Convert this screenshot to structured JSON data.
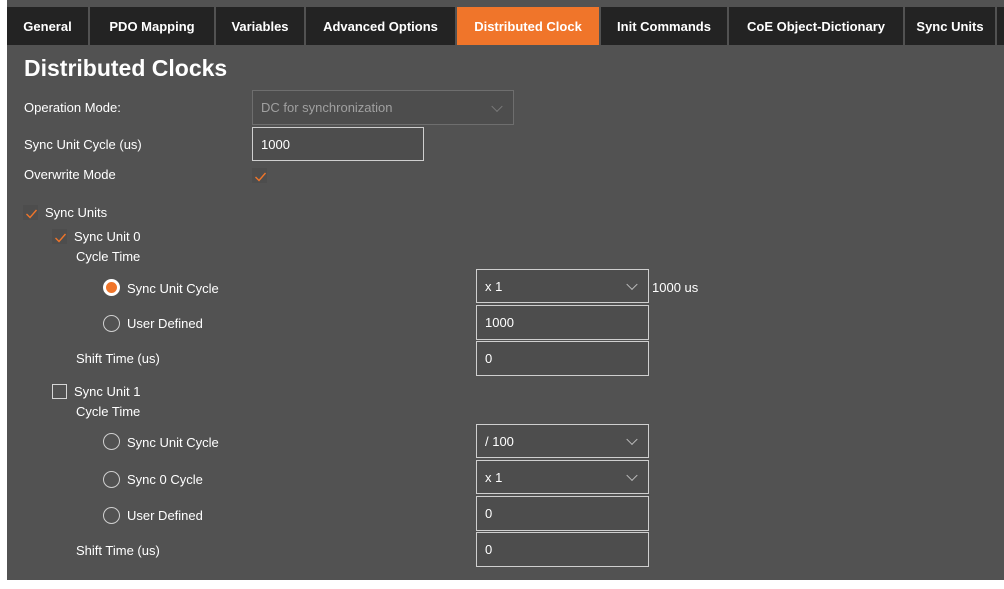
{
  "tabs": [
    {
      "label": "General",
      "active": false
    },
    {
      "label": "PDO Mapping",
      "active": false
    },
    {
      "label": "Variables",
      "active": false
    },
    {
      "label": "Advanced Options",
      "active": false
    },
    {
      "label": "Distributed Clock",
      "active": true
    },
    {
      "label": "Init Commands",
      "active": false
    },
    {
      "label": "CoE Object-Dictionary",
      "active": false
    },
    {
      "label": "Sync Units",
      "active": false
    }
  ],
  "heading": "Distributed Clocks",
  "operation_mode": {
    "label": "Operation Mode:",
    "value": "DC for synchronization",
    "enabled": false
  },
  "sync_unit_cycle": {
    "label": "Sync Unit Cycle (us)",
    "value": "1000"
  },
  "overwrite_mode": {
    "label": "Overwrite Mode",
    "checked": true
  },
  "sync_units": {
    "label": "Sync Units",
    "checked": true,
    "unit0": {
      "label": "Sync Unit 0",
      "checked": true,
      "cycle_time_label": "Cycle Time",
      "sync_unit_cycle": {
        "label": "Sync Unit Cycle",
        "selected": true,
        "value": "x 1",
        "unit_text": "1000 us"
      },
      "user_defined": {
        "label": "User Defined",
        "selected": false,
        "value": "1000"
      },
      "shift_time": {
        "label": "Shift Time (us)",
        "value": "0"
      }
    },
    "unit1": {
      "label": "Sync Unit 1",
      "checked": false,
      "cycle_time_label": "Cycle Time",
      "sync_unit_cycle": {
        "label": "Sync Unit Cycle",
        "selected": false,
        "value": "/ 100"
      },
      "sync0_cycle": {
        "label": "Sync 0 Cycle",
        "selected": false,
        "value": "x 1"
      },
      "user_defined": {
        "label": "User Defined",
        "selected": false,
        "value": "0"
      },
      "shift_time": {
        "label": "Shift Time (us)",
        "value": "0"
      }
    }
  },
  "colors": {
    "accent": "#f0752a",
    "panel": "#525252",
    "tab_bg": "#232323"
  }
}
